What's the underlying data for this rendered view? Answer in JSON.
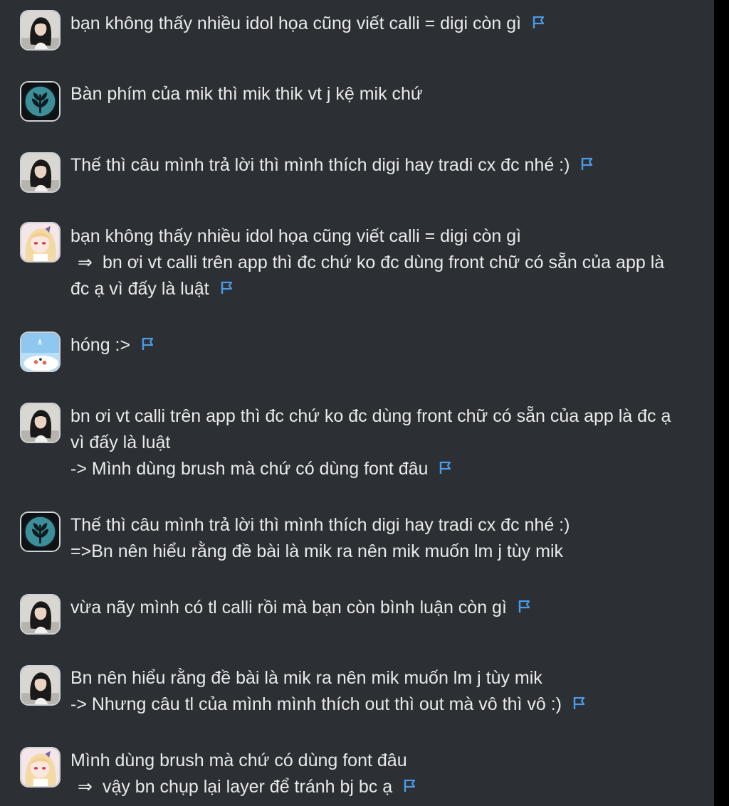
{
  "colors": {
    "background": "#2c2f33",
    "text": "#e8eaed",
    "flag": "#4a9be8"
  },
  "messages": [
    {
      "avatar": "girl-dark-hair-avatar",
      "lines": [
        "bạn không thấy nhiều idol họa cũng viết calli = digi còn gì"
      ],
      "flag": true
    },
    {
      "avatar": "plant-logo-avatar",
      "lines": [
        "Bàn phím của mik thì mik thik vt j kệ mik chứ"
      ],
      "flag": false
    },
    {
      "avatar": "girl-dark-hair-avatar",
      "lines": [
        "Thế thì câu mình trả lời thì mình thích digi hay tradi cx đc nhé :)"
      ],
      "flag": true
    },
    {
      "avatar": "anime-blonde-avatar",
      "lines": [
        "bạn không thấy nhiều idol họa cũng viết calli = digi còn gì",
        "⇒ bn ơi vt calli trên app thì đc chứ ko đc dùng front chữ có sẵn của app là",
        "đc ạ vì đấy là luật"
      ],
      "flag": true
    },
    {
      "avatar": "sky-cartoon-avatar",
      "lines": [
        "hóng :>"
      ],
      "flag": true
    },
    {
      "avatar": "girl-dark-hair-avatar",
      "lines": [
        "bn ơi vt calli trên app thì đc chứ ko đc dùng front chữ có sẵn của app là đc ạ",
        "vì đấy là luật",
        "-> Mình dùng brush mà chứ có dùng font đâu"
      ],
      "flag": true
    },
    {
      "avatar": "plant-logo-avatar",
      "lines": [
        "Thế thì câu mình trả lời thì mình thích digi hay tradi cx đc nhé :)",
        "=>Bn nên hiểu rằng đề bài là mik ra nên mik muốn lm j tùy mik"
      ],
      "flag": false
    },
    {
      "avatar": "girl-dark-hair-avatar",
      "lines": [
        "vừa nãy mình có tl calli rồi mà bạn còn bình luận còn gì"
      ],
      "flag": true
    },
    {
      "avatar": "girl-dark-hair-avatar",
      "lines": [
        "Bn nên hiểu rằng đề bài là mik ra nên mik muốn lm j tùy mik",
        "-> Nhưng câu tl của mình mình thích out thì out mà vô thì vô :)"
      ],
      "flag": true
    },
    {
      "avatar": "anime-blonde-avatar",
      "lines": [
        "Mình dùng brush mà chứ có dùng font đâu",
        "⇒ vậy bn chụp lại layer để tránh bj bc ạ"
      ],
      "flag": true
    }
  ]
}
